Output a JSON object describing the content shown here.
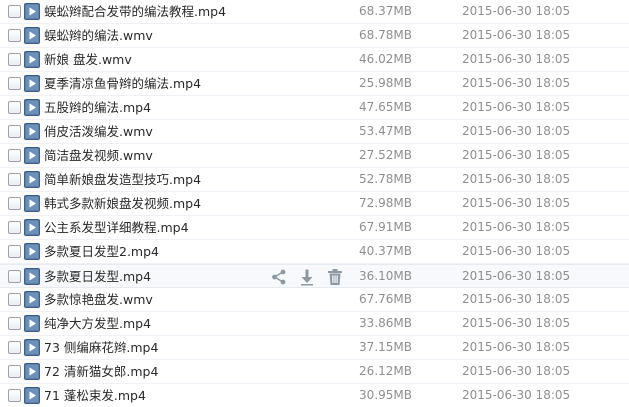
{
  "colors": {
    "icon_frame": "#3e5f88",
    "icon_fill": "#5a7fa9",
    "action_icon": "#8e99a6"
  },
  "icons": {
    "file_type": "video-file-icon",
    "share": "share-icon",
    "download": "download-icon",
    "delete": "trash-icon"
  },
  "hovered_index": 11,
  "files": [
    {
      "name": "蜈蚣辫配合发带的编法教程.mp4",
      "size": "68.37MB",
      "date": "2015-06-30 18:05"
    },
    {
      "name": "蜈蚣辫的编法.wmv",
      "size": "68.78MB",
      "date": "2015-06-30 18:05"
    },
    {
      "name": "新娘 盘发.wmv",
      "size": "46.02MB",
      "date": "2015-06-30 18:05"
    },
    {
      "name": "夏季清凉鱼骨辫的编法.mp4",
      "size": "25.98MB",
      "date": "2015-06-30 18:05"
    },
    {
      "name": "五股辫的编法.mp4",
      "size": "47.65MB",
      "date": "2015-06-30 18:05"
    },
    {
      "name": "俏皮活泼编发.wmv",
      "size": "53.47MB",
      "date": "2015-06-30 18:05"
    },
    {
      "name": "简洁盘发视频.wmv",
      "size": "27.52MB",
      "date": "2015-06-30 18:05"
    },
    {
      "name": "简单新娘盘发造型技巧.mp4",
      "size": "52.78MB",
      "date": "2015-06-30 18:05"
    },
    {
      "name": "韩式多款新娘盘发视频.mp4",
      "size": "72.98MB",
      "date": "2015-06-30 18:05"
    },
    {
      "name": "公主系发型详细教程.mp4",
      "size": "67.91MB",
      "date": "2015-06-30 18:05"
    },
    {
      "name": "多款夏日发型2.mp4",
      "size": "40.37MB",
      "date": "2015-06-30 18:05"
    },
    {
      "name": "多款夏日发型.mp4",
      "size": "36.10MB",
      "date": "2015-06-30 18:05"
    },
    {
      "name": "多款惊艳盘发.wmv",
      "size": "67.76MB",
      "date": "2015-06-30 18:05"
    },
    {
      "name": "纯净大方发型.mp4",
      "size": "33.86MB",
      "date": "2015-06-30 18:05"
    },
    {
      "name": "73 侧编麻花辫.mp4",
      "size": "37.15MB",
      "date": "2015-06-30 18:05"
    },
    {
      "name": "72 清新猫女郎.mp4",
      "size": "26.12MB",
      "date": "2015-06-30 18:05"
    },
    {
      "name": "71 蓬松束发.mp4",
      "size": "30.95MB",
      "date": "2015-06-30 18:05"
    }
  ]
}
